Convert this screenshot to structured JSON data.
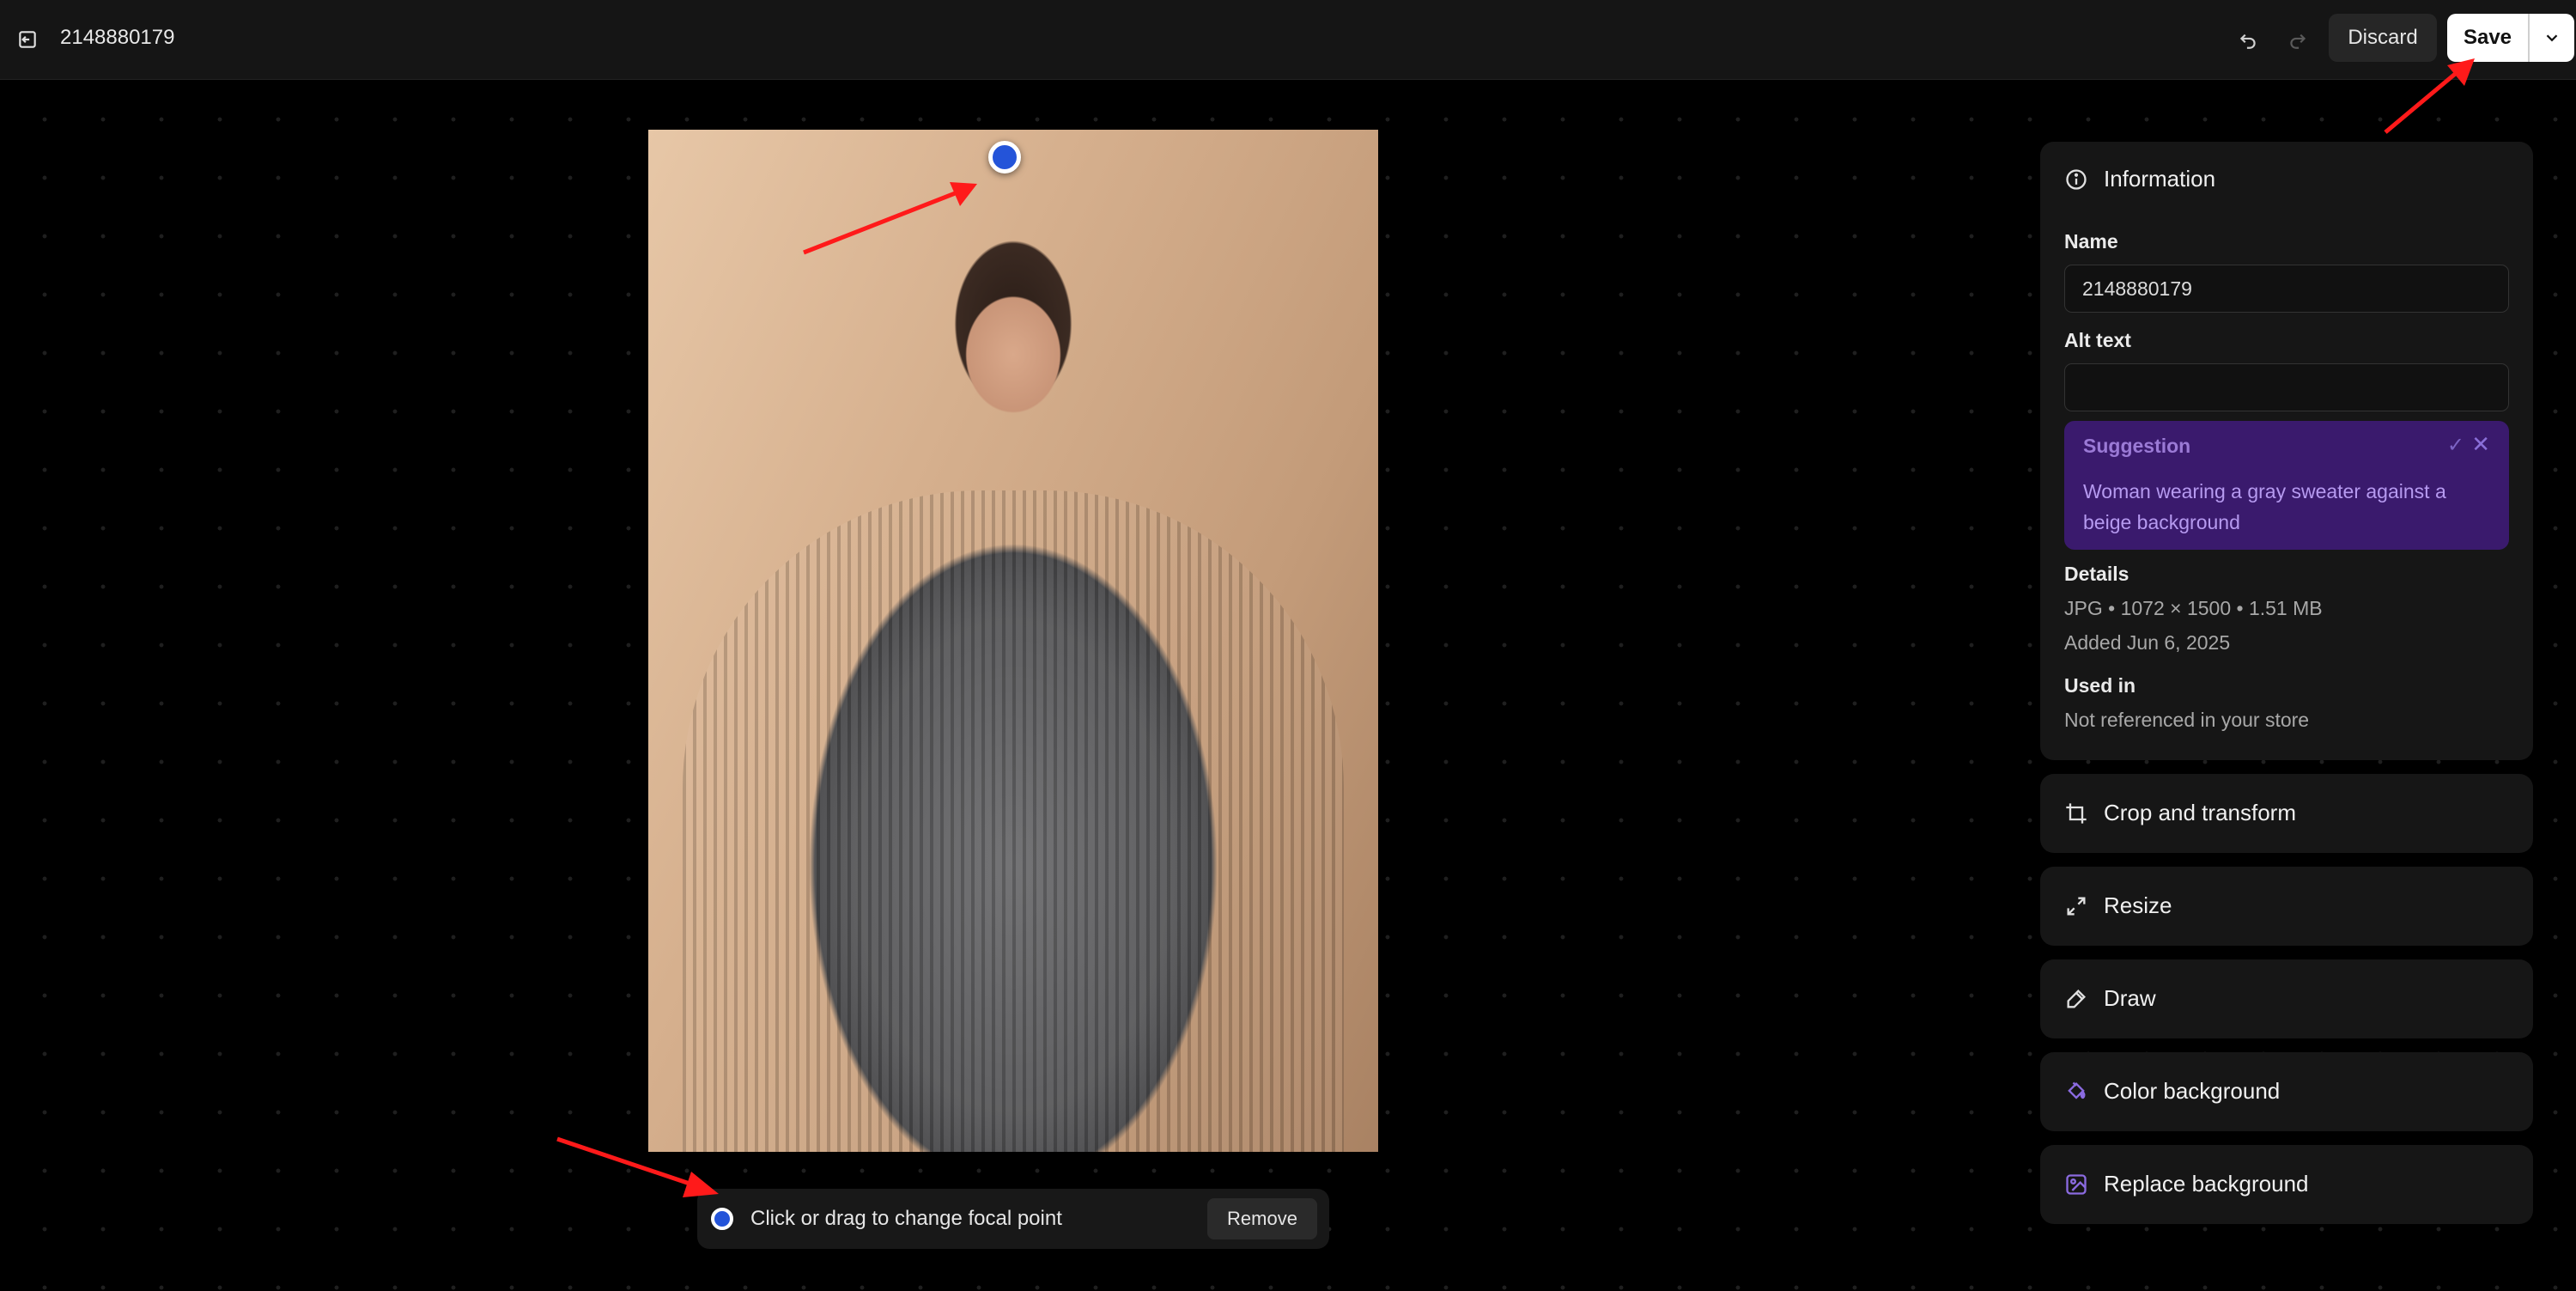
{
  "header": {
    "title": "2148880179",
    "discard_label": "Discard",
    "save_label": "Save"
  },
  "focal": {
    "instruction": "Click or drag to change focal point",
    "remove_label": "Remove"
  },
  "info": {
    "heading": "Information",
    "name_label": "Name",
    "name_value": "2148880179",
    "alt_label": "Alt text",
    "alt_value": "",
    "suggestion_title": "Suggestion",
    "suggestion_accept": "✓",
    "suggestion_reject": "✕",
    "suggestion_text": "Woman wearing a gray sweater against a beige background",
    "details_label": "Details",
    "details_meta": "JPG • 1072 × 1500 • 1.51 MB",
    "details_added": "Added Jun 6, 2025",
    "used_in_label": "Used in",
    "used_in_value": "Not referenced in your store"
  },
  "tools": [
    {
      "label": "Crop and transform",
      "icon": "crop-icon"
    },
    {
      "label": "Resize",
      "icon": "resize-icon"
    },
    {
      "label": "Draw",
      "icon": "pen-icon"
    },
    {
      "label": "Color background",
      "icon": "color-bucket-icon"
    },
    {
      "label": "Replace background",
      "icon": "replace-image-icon"
    }
  ],
  "colors": {
    "accent_purple": "#7b5cd6",
    "focal_blue": "#2454d9",
    "annotation_red": "#ff1a1a"
  }
}
